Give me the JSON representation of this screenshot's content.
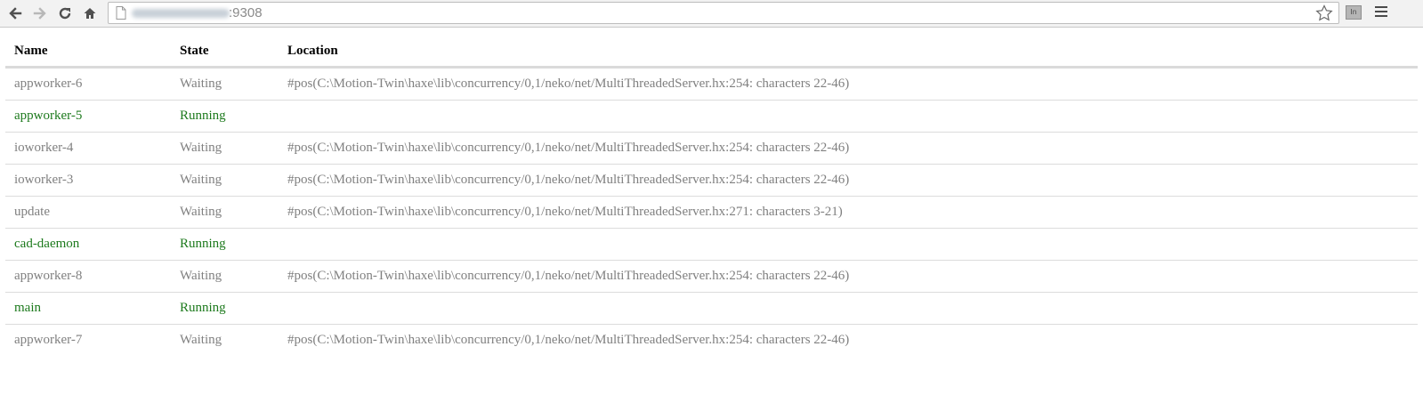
{
  "browser": {
    "url_port": ":9308",
    "icons": [
      "back-icon",
      "forward-icon",
      "reload-icon",
      "home-icon",
      "page-icon",
      "star-icon",
      "extension-icon",
      "menu-icon"
    ],
    "extension_label": "In"
  },
  "table": {
    "headers": {
      "name": "Name",
      "state": "State",
      "location": "Location"
    },
    "rows": [
      {
        "name": "appworker-6",
        "state": "Waiting",
        "location": "#pos(C:\\Motion-Twin\\haxe\\lib\\concurrency/0,1/neko/net/MultiThreadedServer.hx:254: characters 22-46)"
      },
      {
        "name": "appworker-5",
        "state": "Running",
        "location": ""
      },
      {
        "name": "ioworker-4",
        "state": "Waiting",
        "location": "#pos(C:\\Motion-Twin\\haxe\\lib\\concurrency/0,1/neko/net/MultiThreadedServer.hx:254: characters 22-46)"
      },
      {
        "name": "ioworker-3",
        "state": "Waiting",
        "location": "#pos(C:\\Motion-Twin\\haxe\\lib\\concurrency/0,1/neko/net/MultiThreadedServer.hx:254: characters 22-46)"
      },
      {
        "name": "update",
        "state": "Waiting",
        "location": "#pos(C:\\Motion-Twin\\haxe\\lib\\concurrency/0,1/neko/net/MultiThreadedServer.hx:271: characters 3-21)"
      },
      {
        "name": "cad-daemon",
        "state": "Running",
        "location": ""
      },
      {
        "name": "appworker-8",
        "state": "Waiting",
        "location": "#pos(C:\\Motion-Twin\\haxe\\lib\\concurrency/0,1/neko/net/MultiThreadedServer.hx:254: characters 22-46)"
      },
      {
        "name": "main",
        "state": "Running",
        "location": ""
      },
      {
        "name": "appworker-7",
        "state": "Waiting",
        "location": "#pos(C:\\Motion-Twin\\haxe\\lib\\concurrency/0,1/neko/net/MultiThreadedServer.hx:254: characters 22-46)"
      }
    ]
  },
  "colors": {
    "running": "#1d7a1d",
    "waiting": "#808080",
    "header": "#000000"
  }
}
